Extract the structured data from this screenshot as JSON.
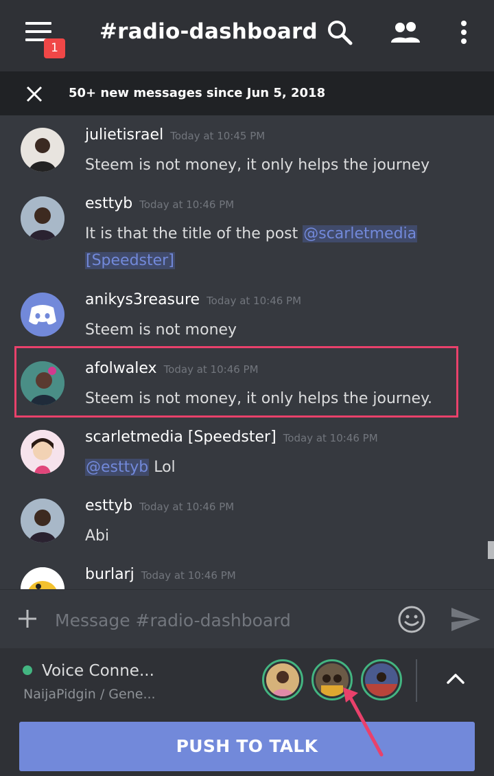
{
  "header": {
    "notification_count": "1",
    "channel_title": "#radio-dashboard",
    "icons": [
      "hamburger-menu-icon",
      "search-icon",
      "members-icon",
      "more-vertical-icon"
    ]
  },
  "notice": {
    "text": "50+ new messages since Jun 5, 2018"
  },
  "messages": [
    {
      "author": "julietisrael",
      "time": "Today at 10:45 PM",
      "text": "Steem is not money, it only helps the journey"
    },
    {
      "author": "esttyb",
      "time": "Today at 10:46 PM",
      "text": "It is that the title of the post ",
      "mention": "@scarletmedia",
      "mention_cont": "[Speedster]"
    },
    {
      "author": "anikys3reasure",
      "time": "Today at 10:46 PM",
      "text": "Steem is not money"
    },
    {
      "author": "afolwalex",
      "time": "Today at 10:46 PM",
      "text": "Steem is not money, it only helps the journey."
    },
    {
      "author": "scarletmedia [Speedster]",
      "time": "Today at 10:46 PM",
      "mention": "@esttyb",
      "text": " Lol"
    },
    {
      "author": "esttyb",
      "time": "Today at 10:46 PM",
      "text": "Abi"
    },
    {
      "author": "burlarj",
      "time": "Today at 10:46 PM"
    }
  ],
  "composer": {
    "placeholder": "Message #radio-dashboard"
  },
  "voice": {
    "status": "Voice Conne...",
    "channel": "NaijaPidgin / Gene...",
    "push_to_talk": "PUSH TO TALK"
  },
  "colors": {
    "accent": "#7289da",
    "online": "#43b581",
    "alert": "#f04747",
    "highlight_box": "#e9416b"
  }
}
